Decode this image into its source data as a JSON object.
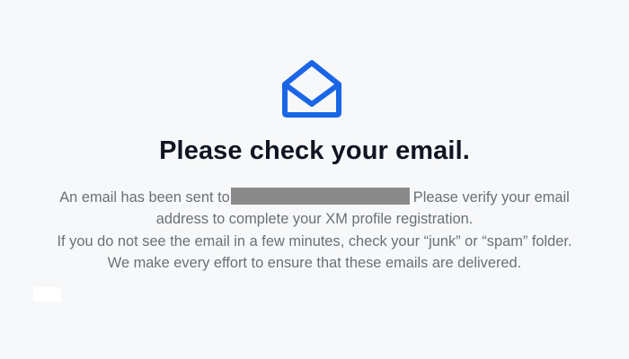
{
  "icon": "envelope-open-icon",
  "accent_color": "#1a66e6",
  "title": "Please check your email.",
  "message": {
    "line1_prefix": "An email has been sent to",
    "line1_suffix": "Please verify your email",
    "line2": "address to complete your XM profile registration.",
    "line3": "If you do not see the email in a few minutes, check your “junk” or “spam” folder.",
    "line4": "We make every effort to ensure that these emails are delivered."
  }
}
